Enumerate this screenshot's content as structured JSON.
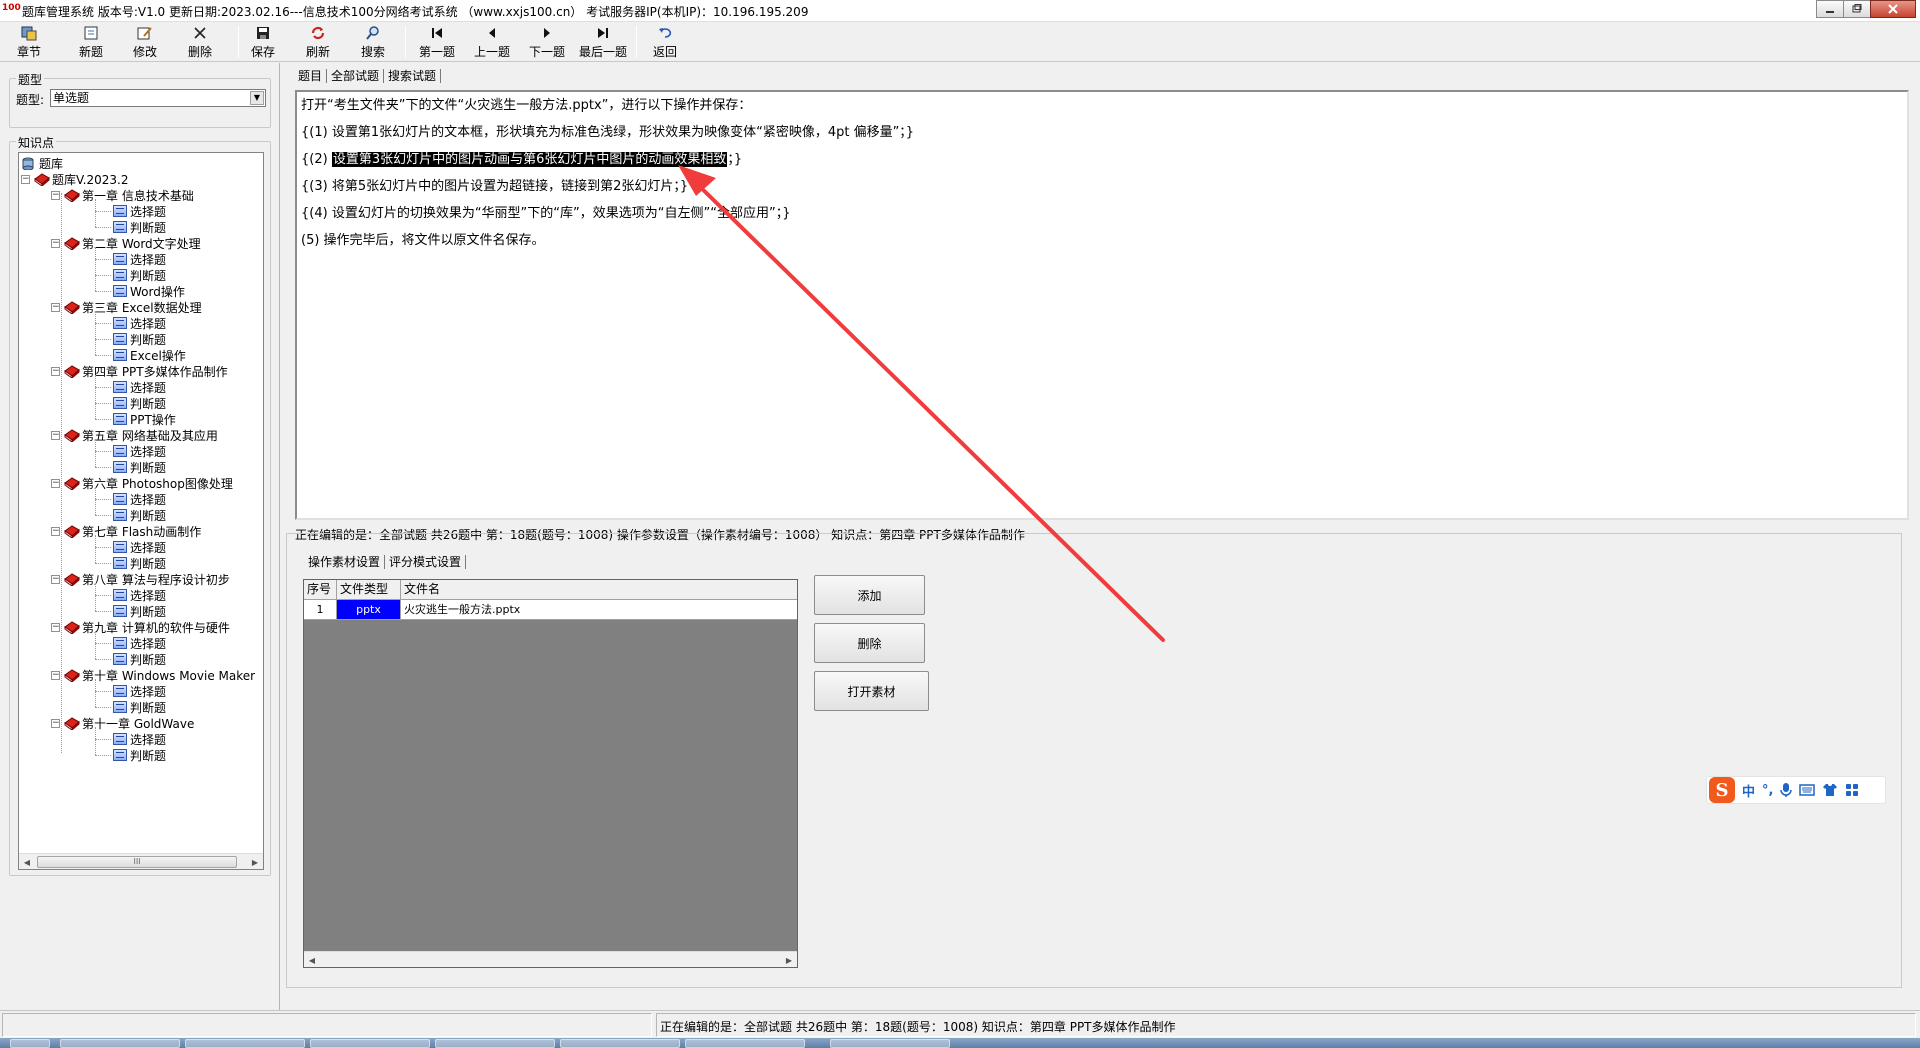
{
  "window": {
    "title": "题库管理系统 版本号:V1.0 更新日期:2023.02.16---信息技术100分网络考试系统 （www.xxjs100.cn） 考试服务器IP(本机IP)：10.196.195.209",
    "app_icon_text": "100"
  },
  "toolbar": {
    "chapter": "章节",
    "new": "新题",
    "edit": "修改",
    "delete": "删除",
    "save": "保存",
    "refresh": "刷新",
    "search": "搜索",
    "first": "第一题",
    "prev": "上一题",
    "next": "下一题",
    "last": "最后一题",
    "back": "返回"
  },
  "left": {
    "type_group_title": "题型",
    "type_label": "题型:",
    "type_value": "单选题",
    "kp_group_title": "知识点",
    "tree": {
      "root": "题库",
      "bank": "题库V.2023.2",
      "chapters": [
        {
          "label": "第一章 信息技术基础",
          "items": [
            "选择题",
            "判断题"
          ]
        },
        {
          "label": "第二章 Word文字处理",
          "items": [
            "选择题",
            "判断题",
            "Word操作"
          ]
        },
        {
          "label": "第三章 Excel数据处理",
          "items": [
            "选择题",
            "判断题",
            "Excel操作"
          ]
        },
        {
          "label": "第四章 PPT多媒体作品制作",
          "items": [
            "选择题",
            "判断题",
            "PPT操作"
          ]
        },
        {
          "label": "第五章 网络基础及其应用",
          "items": [
            "选择题",
            "判断题"
          ]
        },
        {
          "label": "第六章 Photoshop图像处理",
          "items": [
            "选择题",
            "判断题"
          ]
        },
        {
          "label": "第七章 Flash动画制作",
          "items": [
            "选择题",
            "判断题"
          ]
        },
        {
          "label": "第八章 算法与程序设计初步",
          "items": [
            "选择题",
            "判断题"
          ]
        },
        {
          "label": "第九章 计算机的软件与硬件",
          "items": [
            "选择题",
            "判断题"
          ]
        },
        {
          "label": "第十章 Windows Movie Maker",
          "items": [
            "选择题",
            "判断题"
          ]
        },
        {
          "label": "第十一章 GoldWave",
          "items": [
            "选择题",
            "判断题"
          ]
        }
      ]
    },
    "scroll_thumb": "III"
  },
  "question_tabs": [
    "题目",
    "全部试题",
    "搜索试题"
  ],
  "question": {
    "line0": "打开“考生文件夹”下的文件“火灾逃生一般方法.pptx”，进行以下操作并保存：",
    "line1": "{(1) 设置第1张幻灯片的文本框，形状填充为标准色浅绿，形状效果为映像变体“紧密映像，4pt 偏移量”；}",
    "line2_pre": "{(2) ",
    "line2_hl": "设置第3张幻灯片中的图片动画与第6张幻灯片中图片的动画效果相致",
    "line2_post": "；}",
    "line3": "{(3) 将第5张幻灯片中的图片设置为超链接，链接到第2张幻灯片；}",
    "line4": "{(4) 设置幻灯片的切换效果为“华丽型”下的“库”，效果选项为“自左侧”“全部应用”；}",
    "line5": "(5) 操作完毕后，将文件以原文件名保存。"
  },
  "editing_status": "正在编辑的是：全部试题 共26题中  第：18题(题号：1008) 操作参数设置（操作素材编号：1008） 知识点：第四章 PPT多媒体作品制作",
  "settings_tabs": [
    "操作素材设置",
    "评分模式设置"
  ],
  "material_table": {
    "headers": [
      "序号",
      "文件类型",
      "文件名"
    ],
    "rows": [
      {
        "index": "1",
        "type": "pptx",
        "name": "火灾逃生一般方法.pptx"
      }
    ]
  },
  "buttons": {
    "add": "添加",
    "remove": "删除",
    "open": "打开素材"
  },
  "ime": {
    "logo": "S",
    "lang": "中",
    "punct": "°,"
  },
  "statusbar": {
    "message": "正在编辑的是：全部试题 共26题中  第：18题(题号：1008)  知识点：第四章 PPT多媒体作品制作"
  },
  "colors": {
    "file_type_cell": "#0000ff",
    "annotation_arrow": "#f03c3c",
    "highlight_bg": "#000000"
  }
}
